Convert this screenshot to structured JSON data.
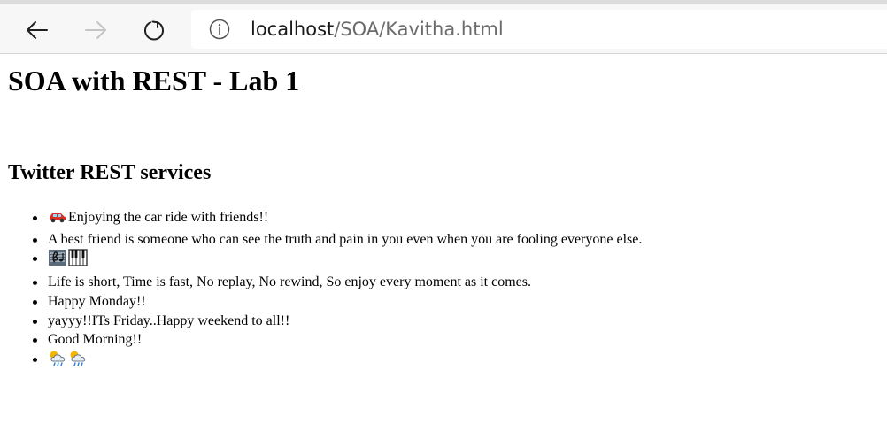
{
  "browser": {
    "url_host": "localhost",
    "url_path": "/SOA/Kavitha.html"
  },
  "page": {
    "title": "SOA with REST - Lab 1",
    "subtitle": "Twitter REST services",
    "tweets": [
      {
        "text": "Enjoying the car ride with friends!!",
        "icons": [
          "car-icon"
        ]
      },
      {
        "text": "A best friend is someone who can see the truth and pain in you even when you are fooling everyone else.",
        "icons": []
      },
      {
        "text": "",
        "icons": [
          "musical-score-icon",
          "piano-keys-icon"
        ]
      },
      {
        "text": "Life is short, Time is fast, No replay, No rewind, So enjoy every moment as it comes.",
        "icons": []
      },
      {
        "text": "Happy Monday!!",
        "icons": []
      },
      {
        "text": "yayyy!!ITs Friday..Happy weekend to all!!",
        "icons": []
      },
      {
        "text": "Good Morning!!",
        "icons": []
      },
      {
        "text": "",
        "icons": [
          "sun-behind-rain-cloud-icon",
          "sun-behind-rain-cloud-icon"
        ]
      }
    ]
  }
}
